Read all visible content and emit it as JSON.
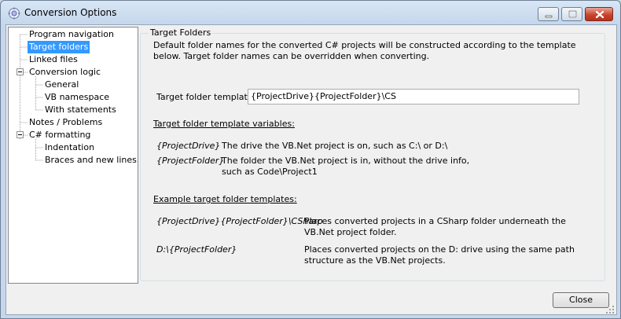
{
  "window": {
    "title": "Conversion Options",
    "icon": "gear-icon"
  },
  "tree": {
    "items": [
      {
        "label": "Program navigation",
        "selected": false
      },
      {
        "label": "Target folders",
        "selected": true
      },
      {
        "label": "Linked files",
        "selected": false
      },
      {
        "label": "Conversion logic",
        "selected": false
      },
      {
        "label": "General",
        "selected": false
      },
      {
        "label": "VB namespace",
        "selected": false
      },
      {
        "label": "With statements",
        "selected": false
      },
      {
        "label": "Notes / Problems",
        "selected": false
      },
      {
        "label": "C# formatting",
        "selected": false
      },
      {
        "label": "Indentation",
        "selected": false
      },
      {
        "label": "Braces and new lines",
        "selected": false
      }
    ]
  },
  "panel": {
    "group_title": "Target Folders",
    "description": "Default folder names for the converted C# projects will be constructed according to the template below.  Target folder names can be overridden when converting.",
    "template_label": "Target folder template:",
    "template_value": "{ProjectDrive}{ProjectFolder}\\CS",
    "variables_heading": "Target folder template variables:",
    "variables": [
      {
        "name": "{ProjectDrive}",
        "desc": "The drive the VB.Net project is on, such as C:\\ or D:\\"
      },
      {
        "name": "{ProjectFolder}",
        "desc": "The folder the VB.Net project is in, without the drive info, such as Code\\Project1"
      }
    ],
    "examples_heading": "Example target folder templates:",
    "examples": [
      {
        "name": "{ProjectDrive}{ProjectFolder}\\CSharp",
        "desc": "Places converted projects in a CSharp folder underneath the VB.Net project folder."
      },
      {
        "name": "D:\\{ProjectFolder}",
        "desc": "Places converted projects on the D: drive using the same path structure as the VB.Net projects."
      }
    ]
  },
  "buttons": {
    "close": "Close"
  },
  "colors": {
    "selection": "#3399ff",
    "window_frame": "#c5d7ec",
    "close_button_red": "#c8452f"
  }
}
